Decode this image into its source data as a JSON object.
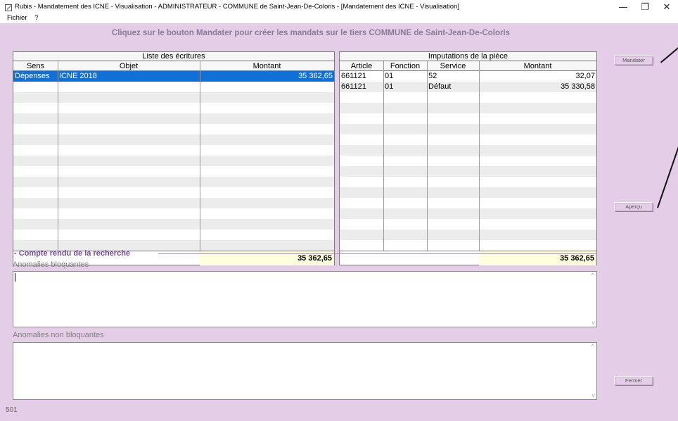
{
  "window": {
    "title": "Rubis - Mandatement des ICNE - Visualisation - ADMINISTRATEUR - COMMUNE de Saint-Jean-De-Coloris - [Mandatement des ICNE - Visualisation]",
    "minimize": "—",
    "maximize": "❐",
    "close": "✕"
  },
  "menu": [
    "Fichier",
    "?"
  ],
  "instruction": "Cliquez sur le bouton Mandater pour créer les mandats sur le tiers COMMUNE de Saint-Jean-De-Coloris",
  "ecritures": {
    "title": "Liste des écritures",
    "columns": [
      "Sens",
      "Objet",
      "Montant"
    ],
    "rows": [
      {
        "sens": "Dépenses",
        "objet": "ICNE 2018",
        "montant": "35 362,65"
      }
    ],
    "total": "35 362,65"
  },
  "imputations": {
    "title": "Imputations de la pièce",
    "columns": [
      "Article",
      "Fonction",
      "Service",
      "Montant"
    ],
    "rows": [
      {
        "article": "661121",
        "fonction": "01",
        "service": "52",
        "montant": "32,07"
      },
      {
        "article": "661121",
        "fonction": "01",
        "service": "Défaut",
        "montant": "35 330,58"
      }
    ],
    "total": "35 362,65"
  },
  "buttons": {
    "mandater": "Mandater",
    "apercu": "Aperçu",
    "fermer": "Fermer"
  },
  "compte_rendu": {
    "title": "- Compte rendu de la recherche",
    "bloquantes_label": "Anomalies bloquantes",
    "non_bloquantes_label": "Anomalies non bloquantes",
    "scroll_up": "^",
    "scroll_down": "v"
  },
  "status": "501",
  "colors": {
    "background": "#e4cde6",
    "selection": "#1070d8",
    "total_fill": "#ffffe0",
    "section_title": "#7a4a9a"
  }
}
